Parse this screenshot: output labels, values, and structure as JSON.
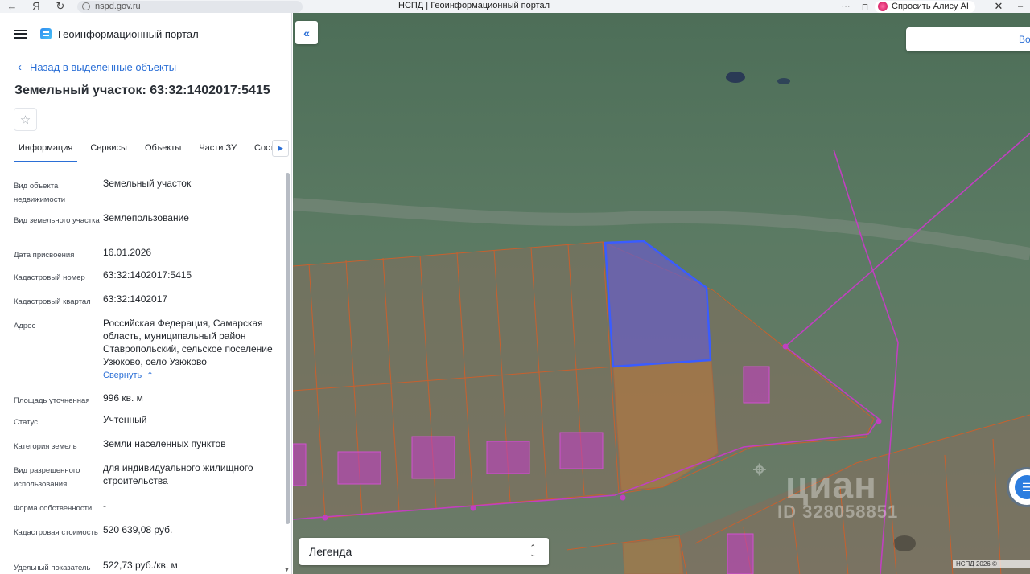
{
  "browser": {
    "url": "nspd.gov.ru",
    "tab_title": "НСПД | Геоинформационный портал",
    "alisa_label": "Спросить Алису AI"
  },
  "panel": {
    "portal_title": "Геоинформационный портал",
    "back_label": "Назад в выделенные объекты",
    "object_title": "Земельный участок: 63:32:1402017:5415",
    "tabs": [
      "Информация",
      "Сервисы",
      "Объекты",
      "Части ЗУ",
      "Состав"
    ],
    "properties": [
      {
        "label": "Вид объекта недвижимости",
        "value": "Земельный участок"
      },
      {
        "label": "Вид земельного участка",
        "value": "Землепользование"
      },
      {
        "label": "Дата присвоения",
        "value": "16.01.2026"
      },
      {
        "label": "Кадастровый номер",
        "value": "63:32:1402017:5415"
      },
      {
        "label": "Кадастровый квартал",
        "value": "63:32:1402017"
      },
      {
        "label": "Адрес",
        "value": "Российская Федерация, Самарская область, муниципальный район Ставропольский, сельское поселение Узюково, село Узюково"
      },
      {
        "label": "Площадь уточненная",
        "value": "996 кв. м"
      },
      {
        "label": "Статус",
        "value": "Учтенный"
      },
      {
        "label": "Категория земель",
        "value": "Земли населенных пунктов"
      },
      {
        "label": "Вид разрешенного использования",
        "value": "для индивидуального жилищного строительства"
      },
      {
        "label": "Форма собственности",
        "value": "-"
      },
      {
        "label": "Кадастровая стоимость",
        "value": "520 639,08 руб."
      },
      {
        "label": "Удельный показатель",
        "value": "522,73 руб./кв. м"
      }
    ],
    "collapse_label": "Свернуть"
  },
  "map": {
    "search_text": "Во",
    "legend_label": "Легенда",
    "copyright": "НСПД 2026 ©",
    "watermark": "циан",
    "watermark_id": "ID 328058851",
    "colors": {
      "parcel_line": "#c8602e",
      "selected_fill": "#6a5fc0",
      "selected_stroke": "#3a5cff",
      "magenta": "#c040c0",
      "orange_fill": "#c07a3a"
    }
  }
}
